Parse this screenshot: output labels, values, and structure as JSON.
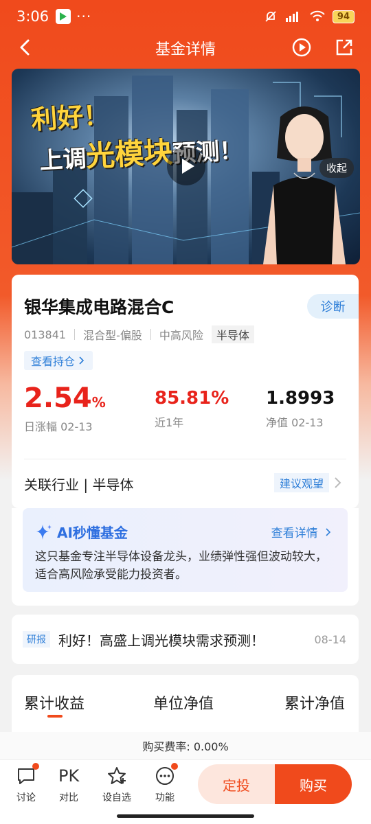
{
  "status_bar": {
    "time": "3:06",
    "dots": "···",
    "battery": "94"
  },
  "nav": {
    "title": "基金详情"
  },
  "video": {
    "headline_line1": "利好！",
    "headline_line2_prefix": "上调",
    "headline_line2_highlight": "光模块",
    "headline_line2_suffix": "预测！",
    "collapse_label": "收起"
  },
  "fund": {
    "name": "银华集成电路混合C",
    "diagnose_label": "诊断",
    "code": "013841",
    "type": "混合型-偏股",
    "risk": "中高风险",
    "sector_tag": "半导体",
    "holdings_label": "查看持仓",
    "metrics": [
      {
        "value": "2.54",
        "unit": "%",
        "label": "日涨幅 02-13",
        "color": "#e8231b"
      },
      {
        "value": "85.81%",
        "label": "近1年",
        "color": "#e8231b"
      },
      {
        "value": "1.8993",
        "label": "净值 02-13",
        "color": "#111111"
      }
    ],
    "industry_label": "关联行业 | 半导体",
    "industry_advice": "建议观望"
  },
  "ai": {
    "title": "AI秒懂基金",
    "more_label": "查看详情",
    "text": "这只基金专注半导体设备龙头，业绩弹性强但波动较大，适合高风险承受能力投资者。"
  },
  "news": {
    "tag": "研报",
    "title": "利好！高盛上调光模块需求预测！",
    "date": "08-14"
  },
  "tabs": [
    "累计收益",
    "单位净值",
    "累计净值"
  ],
  "fee": {
    "text": "购买费率: 0.00%"
  },
  "bottom_bar": {
    "items": [
      {
        "label": "讨论",
        "icon": "chat-icon"
      },
      {
        "label": "对比",
        "icon": "pk-icon",
        "text": "PK"
      },
      {
        "label": "设自选",
        "icon": "star-icon"
      },
      {
        "label": "功能",
        "icon": "more-icon"
      }
    ],
    "fixed_invest_label": "定投",
    "buy_label": "购买"
  },
  "colors": {
    "brand": "#f04a1c",
    "up": "#e8231b",
    "link": "#2f7fd8"
  }
}
